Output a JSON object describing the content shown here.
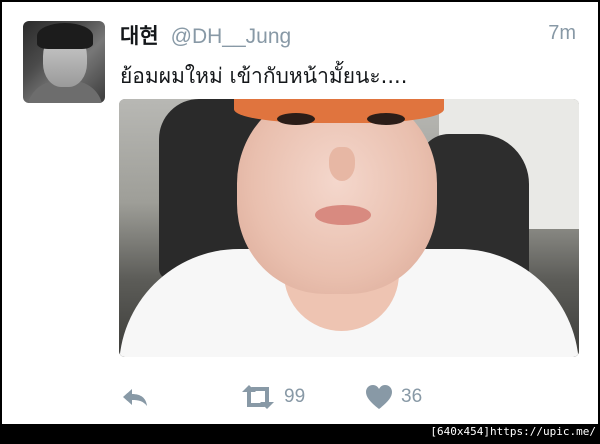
{
  "tweet": {
    "display_name": "대현",
    "handle": "@DH__Jung",
    "timestamp": "7m",
    "text": "ย้อมผมใหม่ เข้ากับหน้ามั้ยนะ....",
    "media_description_icon": "photo"
  },
  "actions": {
    "reply": {
      "icon": "reply-icon"
    },
    "retweet": {
      "icon": "retweet-icon",
      "count": "99"
    },
    "like": {
      "icon": "heart-icon",
      "count": "36"
    }
  },
  "watermark": "[640x454]https://upic.me/",
  "colors": {
    "text": "#14171a",
    "muted": "#8899a6",
    "background": "#ffffff",
    "outer": "#000000"
  }
}
